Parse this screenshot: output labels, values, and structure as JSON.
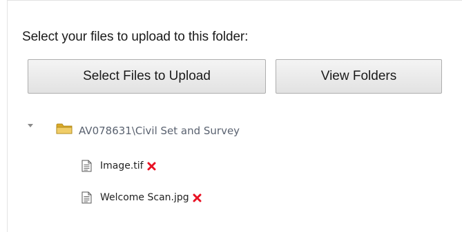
{
  "upload": {
    "prompt": "Select your files to upload to this folder:",
    "select_button_label": "Select Files to Upload",
    "view_button_label": "View Folders"
  },
  "tree": {
    "folder": {
      "name": "AV078631\\Civil Set and Survey",
      "expanded": true,
      "icon": "folder-icon"
    },
    "files": [
      {
        "name": "Image.tif",
        "icon": "file-icon",
        "action_icon": "remove-icon"
      },
      {
        "name": "Welcome Scan.jpg",
        "icon": "file-icon",
        "action_icon": "remove-icon"
      }
    ]
  },
  "colors": {
    "remove": "#e81123",
    "folder_fill": "#e8c25a",
    "folder_label": "#5a6270"
  }
}
